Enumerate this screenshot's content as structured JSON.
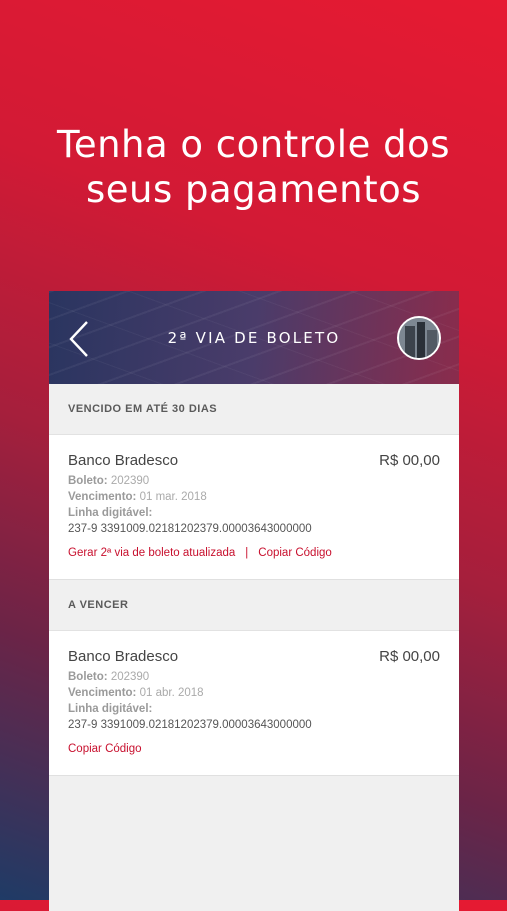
{
  "headline": {
    "line1": "Tenha o controle dos",
    "line2": "seus pagamentos"
  },
  "header": {
    "title": "2ª VIA DE BOLETO"
  },
  "sections": [
    {
      "title": "VENCIDO EM ATÉ 30 DIAS",
      "item": {
        "bank": "Banco Bradesco",
        "amount": "R$ 00,00",
        "boleto_label": "Boleto:",
        "boleto_value": "202390",
        "vencimento_label": "Vencimento:",
        "vencimento_value": "01 mar. 2018",
        "linha_label": "Linha digitável:",
        "linha_value": "237-9 3391009.02181202379.00003643000000",
        "action1": "Gerar 2ª via de boleto atualizada",
        "separator": "|",
        "action2": "Copiar Código"
      }
    },
    {
      "title": "A VENCER",
      "item": {
        "bank": "Banco Bradesco",
        "amount": "R$ 00,00",
        "boleto_label": "Boleto:",
        "boleto_value": "202390",
        "vencimento_label": "Vencimento:",
        "vencimento_value": "01 abr. 2018",
        "linha_label": "Linha digitável:",
        "linha_value": "237-9 3391009.02181202379.00003643000000",
        "action1": "Copiar Código"
      }
    }
  ],
  "colors": {
    "accent": "#c8102e",
    "brand_red": "#e61a32",
    "brand_blue": "#1f3b66"
  },
  "icons": {
    "back": "chevron-left-icon",
    "avatar": "avatar"
  }
}
